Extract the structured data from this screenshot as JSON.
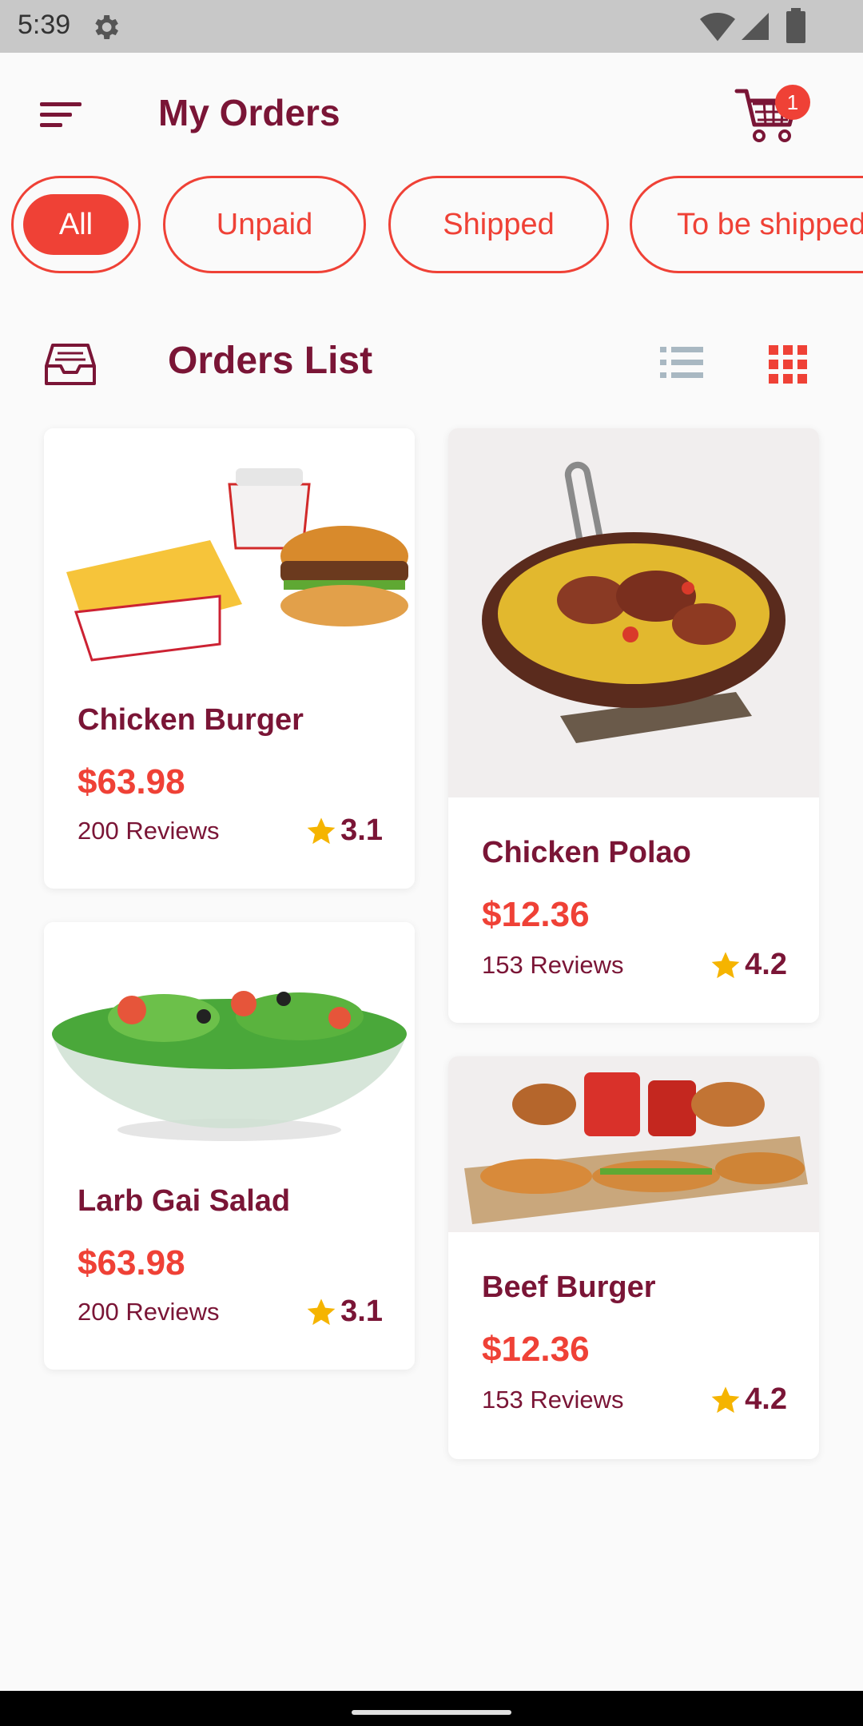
{
  "status_bar": {
    "time": "5:39"
  },
  "header": {
    "title": "My Orders",
    "cart_count": "1"
  },
  "filters": [
    "All",
    "Unpaid",
    "Shipped",
    "To be shipped"
  ],
  "orders_section": {
    "title": "Orders List"
  },
  "orders": [
    {
      "name": "Chicken Burger",
      "price": "$63.98",
      "reviews": "200 Reviews",
      "rating": "3.1"
    },
    {
      "name": "Chicken Polao",
      "price": "$12.36",
      "reviews": "153 Reviews",
      "rating": "4.2"
    },
    {
      "name": "Larb Gai Salad",
      "price": "$63.98",
      "reviews": "200 Reviews",
      "rating": "3.1"
    },
    {
      "name": "Beef Burger",
      "price": "$12.36",
      "reviews": "153 Reviews",
      "rating": "4.2"
    }
  ],
  "colors": {
    "accent": "#ef4136",
    "primary_text": "#7a1536",
    "star": "#f5b400"
  }
}
